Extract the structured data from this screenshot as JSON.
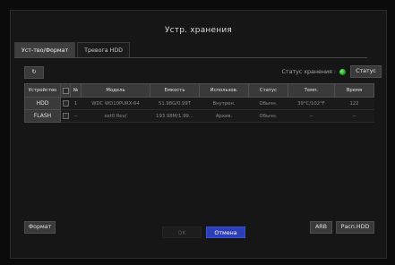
{
  "window": {
    "title": "Устр. хранения"
  },
  "tabs": [
    {
      "label": "Уст-тво/Формат",
      "active": true
    },
    {
      "label": "Тревога HDD",
      "active": false
    }
  ],
  "toolbar": {
    "refresh_icon": "refresh-icon",
    "refresh_glyph": "↻",
    "status_label": "Статус хранения :",
    "status_color": "#19a319",
    "status_button": "Статус"
  },
  "table": {
    "headers": {
      "device": "Устройство",
      "num": "№",
      "model": "Модель",
      "capacity": "Емкость",
      "usage": "Использов.",
      "status": "Статус",
      "temp": "Темп.",
      "time": "Время"
    },
    "rows": [
      {
        "device": "HDD",
        "num": "1",
        "model": "WDC WD10PURX-64",
        "capacity": "51.98G/0.99T",
        "usage": "Внутрен.",
        "status": "Обычн.",
        "temp": "39°C/102°F",
        "time": "122"
      },
      {
        "device": "FLASH",
        "num": "--",
        "model": "ext0 Rev/",
        "capacity": "193.98M/1.99...",
        "usage": "Архив.",
        "status": "Обычн.",
        "temp": "--",
        "time": "--"
      }
    ]
  },
  "buttons": {
    "format": "Формат",
    "arb": "ARB",
    "raspl": "Расп.HDD",
    "ok": "OK",
    "cancel": "Отмена"
  },
  "colors": {
    "accent": "#2c3eb8",
    "ok_led": "#19a319"
  }
}
